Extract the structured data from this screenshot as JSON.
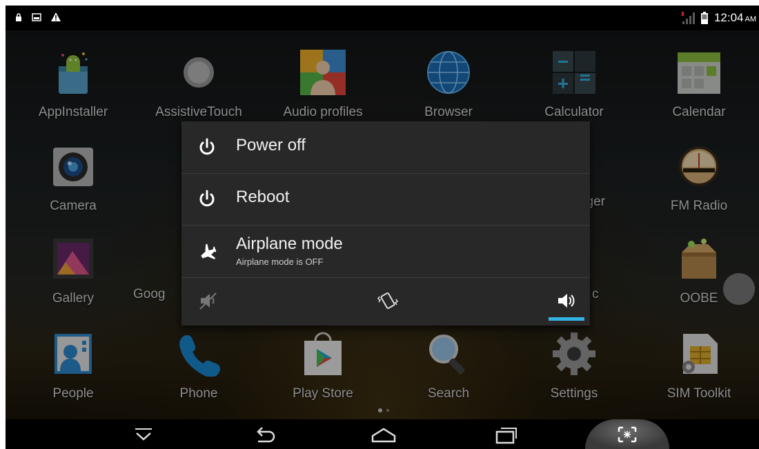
{
  "status_bar": {
    "left_icons": [
      "lock-icon",
      "image-icon",
      "warning-icon"
    ],
    "right_icons": [
      "signal-icon",
      "battery-icon"
    ],
    "time": "12:04",
    "ampm": "AM"
  },
  "apps": [
    {
      "label": "AppInstaller",
      "icon": "android-icon"
    },
    {
      "label": "AssistiveTouch",
      "icon": "assistive-touch-icon"
    },
    {
      "label": "Audio profiles",
      "icon": "audio-profiles-icon"
    },
    {
      "label": "Browser",
      "icon": "globe-icon"
    },
    {
      "label": "Calculator",
      "icon": "calculator-icon"
    },
    {
      "label": "Calendar",
      "icon": "calendar-icon"
    },
    {
      "label": "Camera",
      "icon": "camera-icon"
    },
    {
      "label": "ager",
      "icon": "file-manager-icon"
    },
    {
      "label": "FM Radio",
      "icon": "radio-icon"
    },
    {
      "label": "Gallery",
      "icon": "gallery-icon"
    },
    {
      "label": "Goog",
      "icon": "google-icon"
    },
    {
      "label": "c",
      "icon": "music-icon"
    },
    {
      "label": "OOBE",
      "icon": "box-icon"
    },
    {
      "label": "People",
      "icon": "people-icon"
    },
    {
      "label": "Phone",
      "icon": "phone-icon"
    },
    {
      "label": "Play Store",
      "icon": "play-store-icon"
    },
    {
      "label": "Search",
      "icon": "search-icon"
    },
    {
      "label": "Settings",
      "icon": "settings-icon"
    },
    {
      "label": "SIM Toolkit",
      "icon": "sim-icon"
    }
  ],
  "dialog": {
    "power_off": "Power off",
    "reboot": "Reboot",
    "airplane_mode": "Airplane mode",
    "airplane_status": "Airplane mode is OFF",
    "sound_modes": [
      "silent-mode-icon",
      "vibrate-mode-icon",
      "sound-on-icon"
    ],
    "selected_sound_mode": "sound-on-icon",
    "accent_color": "#33b5e5"
  },
  "nav_bar": {
    "buttons": [
      "hide-keyboard-icon",
      "back-icon",
      "home-icon",
      "recent-apps-icon",
      "screenshot-icon"
    ]
  }
}
